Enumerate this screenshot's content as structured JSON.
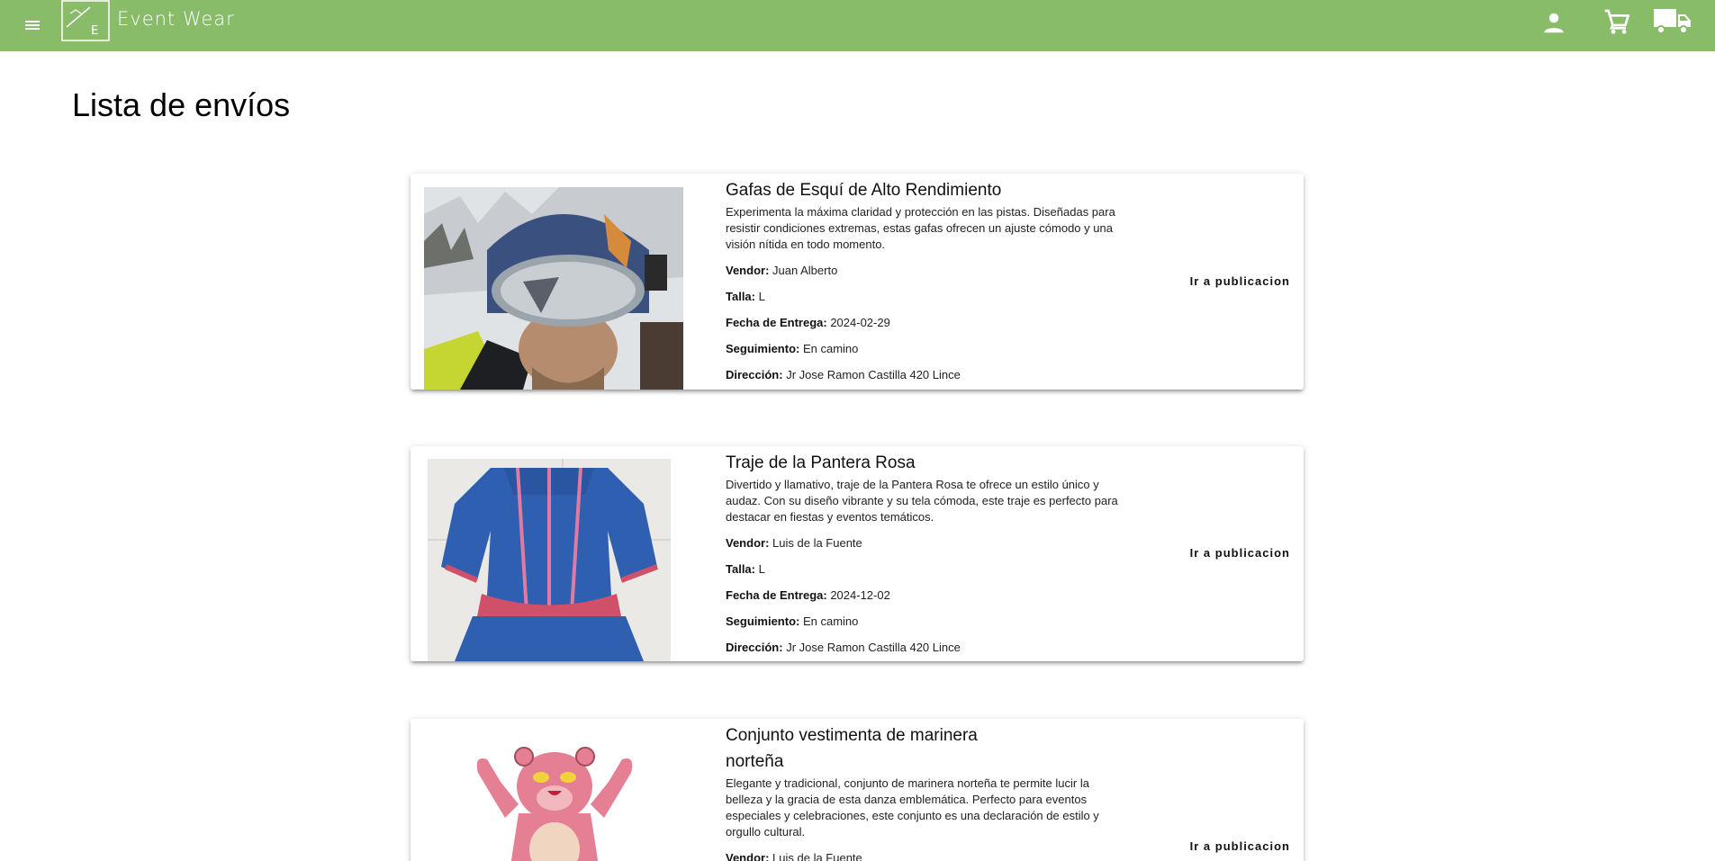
{
  "header": {
    "brand": "Event Wear",
    "logo_letter": "E",
    "accent_color": "#88bc69",
    "icons": [
      "menu-icon",
      "user-icon",
      "cart-icon",
      "truck-icon"
    ]
  },
  "page": {
    "title": "Lista de envíos"
  },
  "labels": {
    "vendor": "Vendor:",
    "size": "Talla:",
    "delivery_date": "Fecha de Entrega:",
    "tracking": "Seguimiento:",
    "address": "Dirección:",
    "go_button": "Ir a publicacion"
  },
  "shipments": [
    {
      "title": "Gafas de Esquí de Alto Rendimiento",
      "description": "Experimenta la máxima claridad y protección en las pistas. Diseñadas para resistir condiciones extremas, estas gafas ofrecen un ajuste cómodo y una visión nítida en todo momento.",
      "vendor": "Juan Alberto",
      "size": "L",
      "delivery_date": "2024-02-29",
      "tracking": "En camino",
      "address": "Jr Jose Ramon Castilla 420 Lince"
    },
    {
      "title": "Traje de la Pantera Rosa",
      "description": "Divertido y llamativo, traje de la Pantera Rosa te ofrece un estilo único y audaz. Con su diseño vibrante y su tela cómoda, este traje es perfecto para destacar en fiestas y eventos temáticos.",
      "vendor": "Luis de la Fuente",
      "size": "L",
      "delivery_date": "2024-12-02",
      "tracking": "En camino",
      "address": "Jr Jose Ramon Castilla 420 Lince"
    },
    {
      "title": "Conjunto vestimenta de marinera norteña",
      "description": "Elegante y tradicional, conjunto de marinera norteña te permite lucir la belleza y la gracia de esta danza emblemática. Perfecto para eventos especiales y celebraciones, este conjunto es una declaración de estilo y orgullo cultural.",
      "vendor": "Luis de la Fuente"
    }
  ]
}
